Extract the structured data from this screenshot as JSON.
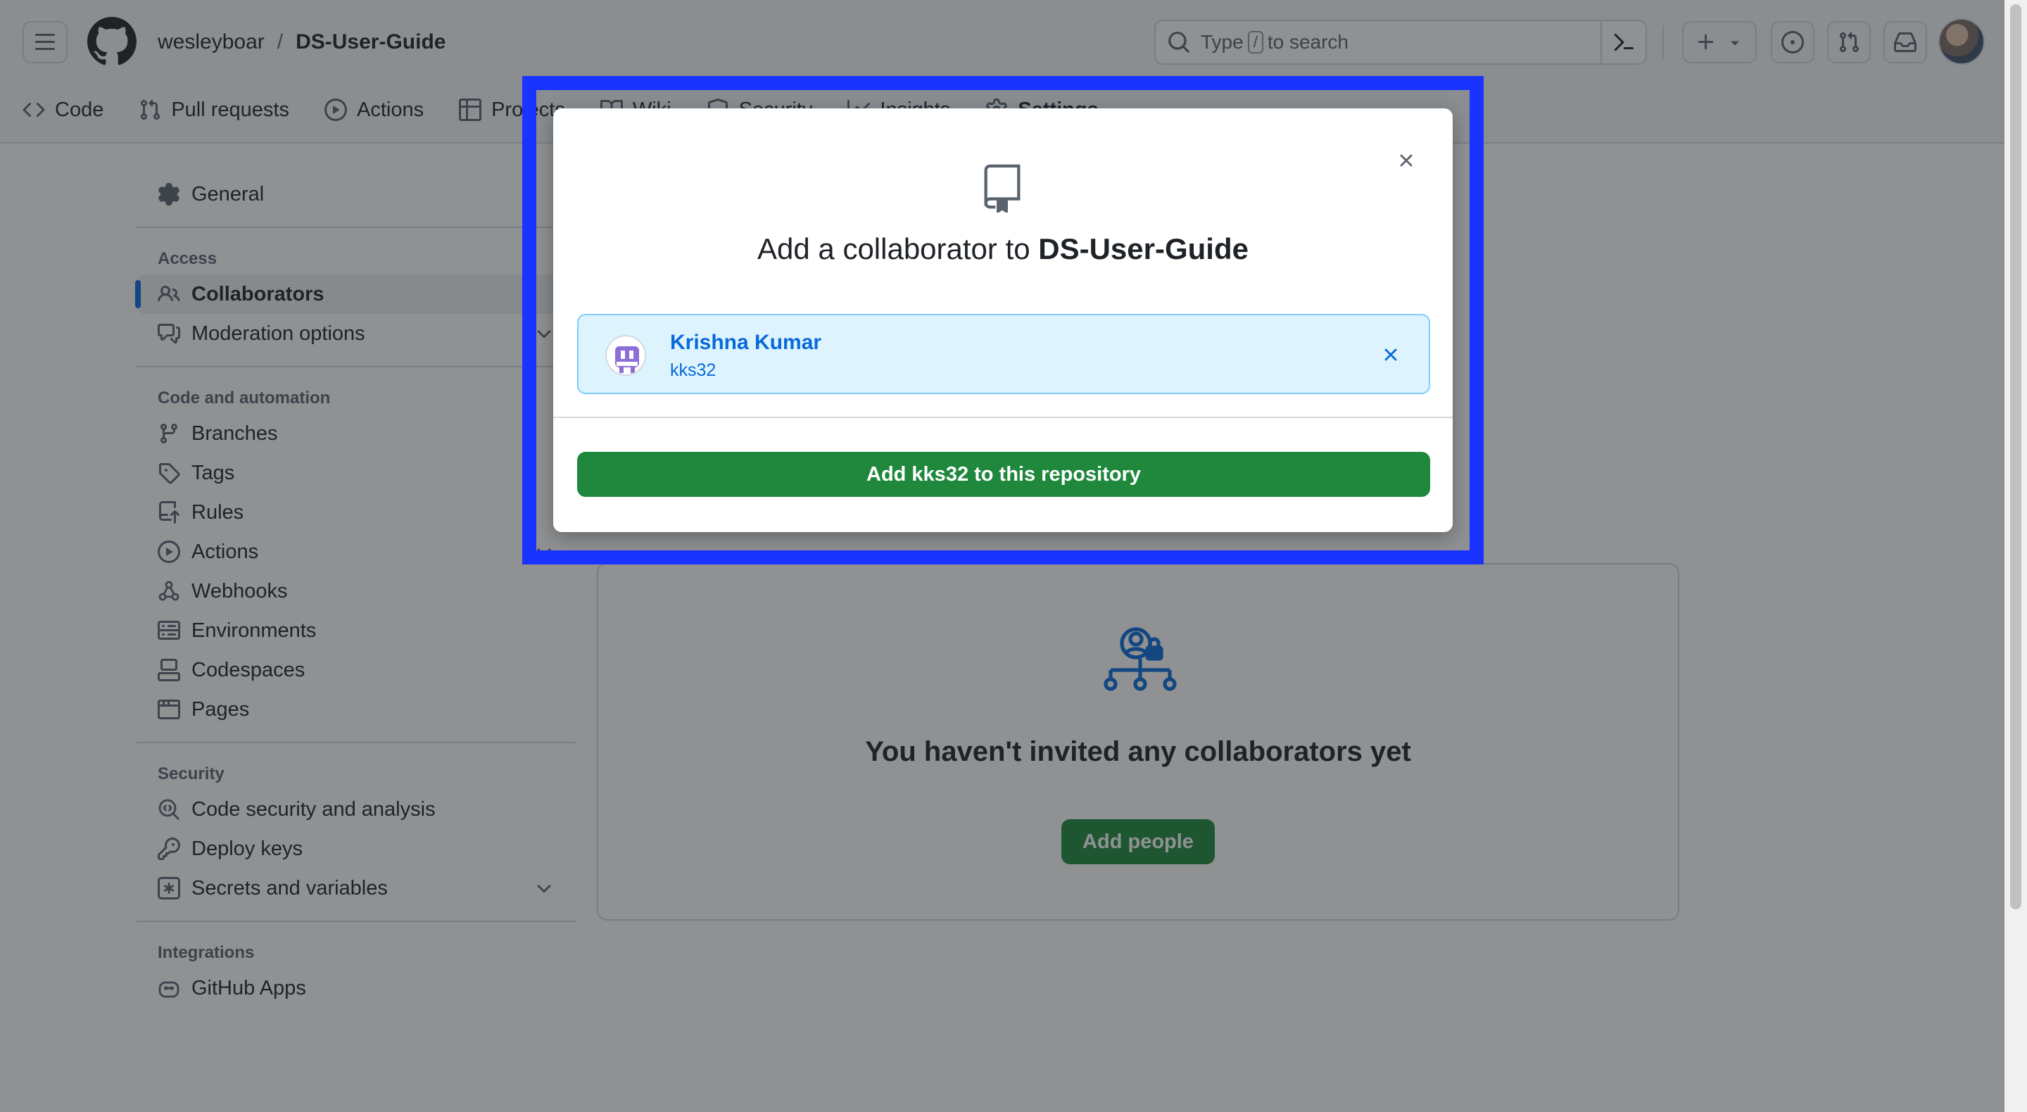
{
  "header": {
    "owner": "wesleyboar",
    "separator": "/",
    "repo": "DS-User-Guide",
    "search": {
      "prefix": "Type",
      "key": "/",
      "suffix": "to search"
    }
  },
  "tabs": [
    {
      "label": "Code",
      "icon": "code-icon"
    },
    {
      "label": "Pull requests",
      "icon": "git-pull-request-icon"
    },
    {
      "label": "Actions",
      "icon": "play-icon"
    },
    {
      "label": "Projects",
      "icon": "table-icon"
    },
    {
      "label": "Wiki",
      "icon": "book-icon"
    },
    {
      "label": "Security",
      "icon": "shield-icon"
    },
    {
      "label": "Insights",
      "icon": "graph-icon"
    },
    {
      "label": "Settings",
      "icon": "gear-icon",
      "selected": true
    }
  ],
  "sidebar": {
    "general": "General",
    "access": {
      "heading": "Access",
      "items": [
        "Collaborators",
        "Moderation options"
      ]
    },
    "code_automation": {
      "heading": "Code and automation",
      "items": [
        "Branches",
        "Tags",
        "Rules",
        "Actions",
        "Webhooks",
        "Environments",
        "Codespaces",
        "Pages"
      ]
    },
    "security": {
      "heading": "Security",
      "items": [
        "Code security and analysis",
        "Deploy keys",
        "Secrets and variables"
      ]
    },
    "integrations": {
      "heading": "Integrations",
      "items": [
        "GitHub Apps"
      ]
    }
  },
  "main": {
    "empty_title": "You haven't invited any collaborators yet",
    "add_people": "Add people"
  },
  "dialog": {
    "title_prefix": "Add a collaborator to",
    "title_repo": "DS-User-Guide",
    "selected_user": {
      "name": "Krishna Kumar",
      "login": "kks32"
    },
    "add_button": "Add kks32 to this repository"
  },
  "colors": {
    "highlight": "#1a33ff",
    "primary_button": "#1f883d",
    "link_blue": "#0969da",
    "selected_user_bg": "#ddf4ff"
  }
}
